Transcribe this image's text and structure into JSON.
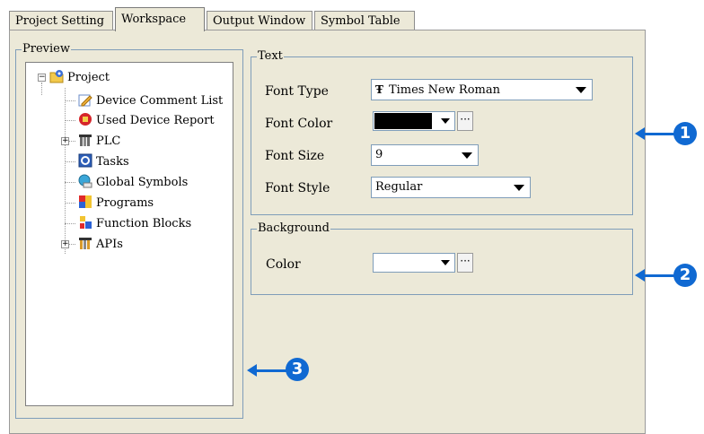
{
  "tabs": [
    "Project Setting",
    "Workspace",
    "Output Window",
    "Symbol Table"
  ],
  "preview": {
    "title": "Preview",
    "tree": [
      {
        "label": "Project",
        "icon": "project-icon"
      },
      {
        "label": "Device Comment List",
        "icon": "device-comment-list-icon"
      },
      {
        "label": "Used Device Report",
        "icon": "used-device-report-icon"
      },
      {
        "label": "PLC",
        "icon": "plc-icon"
      },
      {
        "label": "Tasks",
        "icon": "tasks-icon"
      },
      {
        "label": "Global Symbols",
        "icon": "global-symbols-icon"
      },
      {
        "label": "Programs",
        "icon": "programs-icon"
      },
      {
        "label": "Function Blocks",
        "icon": "function-blocks-icon"
      },
      {
        "label": "APIs",
        "icon": "apis-icon"
      }
    ]
  },
  "text_group": {
    "title": "Text",
    "font_type_label": "Font Type",
    "font_type_value": "Times New Roman",
    "font_color_label": "Font Color",
    "font_color_value": "#000000",
    "font_size_label": "Font Size",
    "font_size_value": "9",
    "font_style_label": "Font Style",
    "font_style_value": "Regular"
  },
  "background_group": {
    "title": "Background",
    "color_label": "Color",
    "color_value": "#ffffff"
  },
  "callouts": [
    "1",
    "2",
    "3"
  ],
  "colors": {
    "accent": "#1069d2",
    "dialog_bg": "#ece9d8",
    "group_border": "#7f9db9"
  }
}
